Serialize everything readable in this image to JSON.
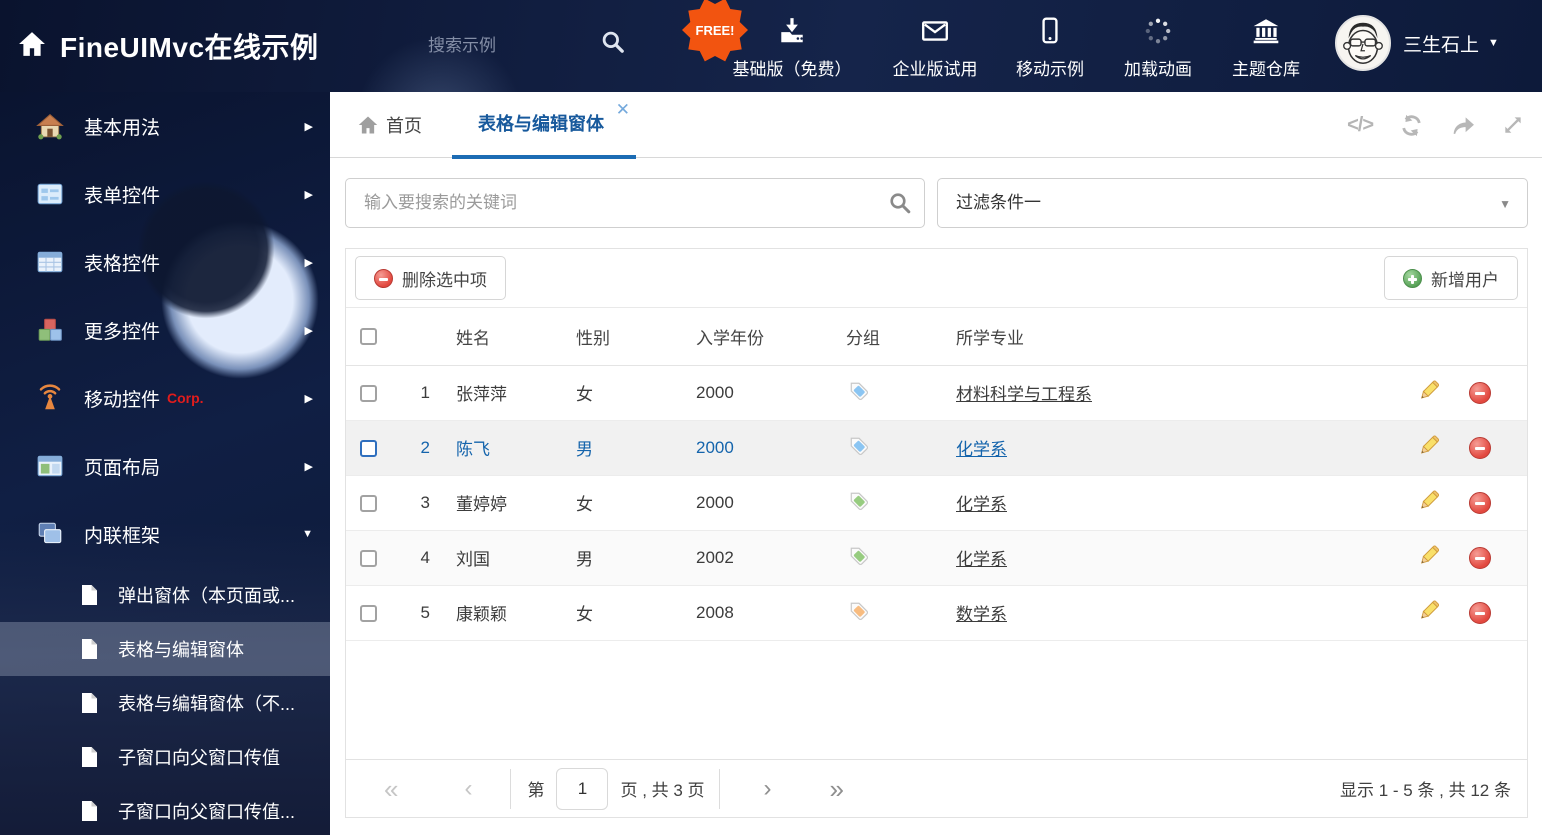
{
  "header": {
    "title": "FineUIMvc在线示例",
    "search_placeholder": "搜索示例",
    "free_badge": "FREE!",
    "nav": [
      {
        "label": "基础版（免费）"
      },
      {
        "label": "企业版试用"
      },
      {
        "label": "移动示例"
      },
      {
        "label": "加载动画"
      },
      {
        "label": "主题仓库"
      }
    ],
    "user_name": "三生石上"
  },
  "sidebar": {
    "items": [
      {
        "label": "基本用法"
      },
      {
        "label": "表单控件"
      },
      {
        "label": "表格控件"
      },
      {
        "label": "更多控件"
      },
      {
        "label": "移动控件",
        "badge": "Corp."
      },
      {
        "label": "页面布局"
      },
      {
        "label": "内联框架"
      }
    ],
    "subitems": [
      {
        "label": "弹出窗体（本页面或..."
      },
      {
        "label": "表格与编辑窗体"
      },
      {
        "label": "表格与编辑窗体（不..."
      },
      {
        "label": "子窗口向父窗口传值"
      },
      {
        "label": "子窗口向父窗口传值..."
      }
    ]
  },
  "tabs": {
    "home": "首页",
    "active": "表格与编辑窗体"
  },
  "filter_bar": {
    "search_placeholder": "输入要搜索的关键词",
    "filter_value": "过滤条件一"
  },
  "toolbar": {
    "delete_label": "删除选中项",
    "add_label": "新增用户"
  },
  "table": {
    "headers": {
      "name": "姓名",
      "gender": "性别",
      "year": "入学年份",
      "group": "分组",
      "major": "所学专业"
    },
    "rows": [
      {
        "index": "1",
        "name": "张萍萍",
        "gender": "女",
        "year": "2000",
        "tag_color": "#8bc5f2",
        "major": "材料科学与工程系"
      },
      {
        "index": "2",
        "name": "陈飞",
        "gender": "男",
        "year": "2000",
        "tag_color": "#8bc5f2",
        "major": "化学系"
      },
      {
        "index": "3",
        "name": "董婷婷",
        "gender": "女",
        "year": "2000",
        "tag_color": "#97cc80",
        "major": "化学系"
      },
      {
        "index": "4",
        "name": "刘国",
        "gender": "男",
        "year": "2002",
        "tag_color": "#97cc80",
        "major": "化学系"
      },
      {
        "index": "5",
        "name": "康颖颖",
        "gender": "女",
        "year": "2008",
        "tag_color": "#f8bc80",
        "major": "数学系"
      }
    ]
  },
  "pagination": {
    "first": "«",
    "prev": "‹",
    "next": "›",
    "last": "»",
    "page_prefix": "第",
    "page_value": "1",
    "page_suffix": "页 , 共 3 页",
    "summary": "显示 1 - 5 条 , 共 12 条"
  },
  "colors": {
    "accent_blue": "#1c6cb4",
    "selected_row_text": "#1464ac",
    "free_badge_orange": "#f25410",
    "delete_red": "#e2483f",
    "add_green": "#55a055"
  }
}
